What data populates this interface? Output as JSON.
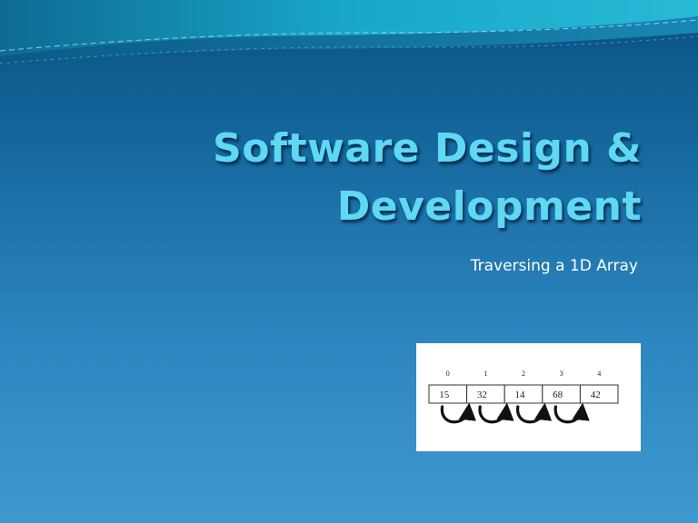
{
  "slide": {
    "title_line1": "Software Design &",
    "title_line2": "Development",
    "subtitle": "Traversing a 1D Array"
  },
  "array_diagram": {
    "indices": [
      "0",
      "1",
      "2",
      "3",
      "4"
    ],
    "values": [
      "15",
      "32",
      "14",
      "68",
      "42"
    ]
  },
  "colors": {
    "background_top": "#0a4f82",
    "background_bottom": "#3f98cf",
    "title": "#5fd8f2",
    "subtitle": "#ffffff"
  }
}
